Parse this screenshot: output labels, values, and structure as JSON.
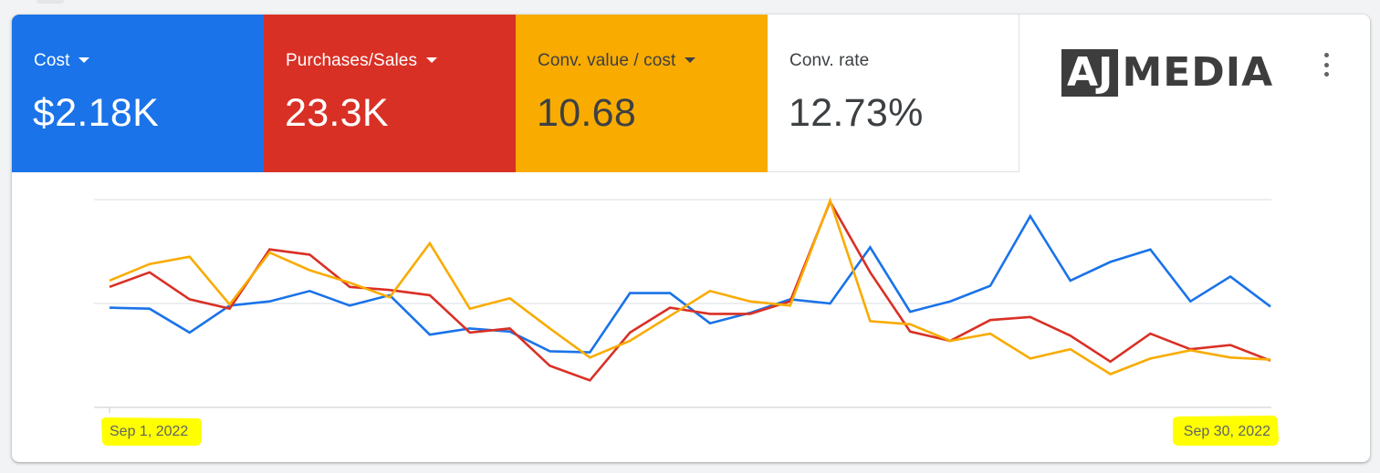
{
  "metrics": [
    {
      "label": "Cost",
      "value": "$2.18K",
      "color": "#1a73e8",
      "dropdown": true
    },
    {
      "label": "Purchases/Sales",
      "value": "23.3K",
      "color": "#d93025",
      "dropdown": true
    },
    {
      "label": "Conv. value / cost",
      "value": "10.68",
      "color": "#f9ab00",
      "dropdown": true
    },
    {
      "label": "Conv. rate",
      "value": "12.73%",
      "color": "#ffffff",
      "dropdown": false
    }
  ],
  "logo": {
    "box_text": "AJ",
    "text": "MEDIA"
  },
  "menu_icon": "more-vert-icon",
  "chart_data": {
    "type": "line",
    "x": [
      "Sep 1, 2022",
      "Sep 2, 2022",
      "Sep 3, 2022",
      "Sep 4, 2022",
      "Sep 5, 2022",
      "Sep 6, 2022",
      "Sep 7, 2022",
      "Sep 8, 2022",
      "Sep 9, 2022",
      "Sep 10, 2022",
      "Sep 11, 2022",
      "Sep 12, 2022",
      "Sep 13, 2022",
      "Sep 14, 2022",
      "Sep 15, 2022",
      "Sep 16, 2022",
      "Sep 17, 2022",
      "Sep 18, 2022",
      "Sep 19, 2022",
      "Sep 20, 2022",
      "Sep 21, 2022",
      "Sep 22, 2022",
      "Sep 23, 2022",
      "Sep 24, 2022",
      "Sep 25, 2022",
      "Sep 26, 2022",
      "Sep 27, 2022",
      "Sep 28, 2022",
      "Sep 29, 2022",
      "Sep 30, 2022"
    ],
    "x_tick_labels": [
      "Sep 1, 2022",
      "Sep 30, 2022"
    ],
    "ylim": [
      0,
      100
    ],
    "grid": true,
    "highlighted_labels": true,
    "series": [
      {
        "color": "#1a73e8",
        "values": [
          48,
          47.5,
          36,
          49,
          51,
          56,
          49,
          54,
          35,
          38,
          36.5,
          27,
          26.5,
          55,
          55,
          40.5,
          45.5,
          52,
          50,
          77,
          46,
          51,
          58.5,
          92,
          61,
          70,
          76,
          51,
          63,
          48.5
        ]
      },
      {
        "color": "#d93025",
        "values": [
          58,
          65,
          52,
          47.5,
          76,
          73.5,
          58,
          56.5,
          54,
          36,
          38,
          20,
          13,
          36,
          48,
          45,
          45,
          51,
          99,
          65,
          36.5,
          32,
          42,
          43.5,
          34.5,
          22,
          35.5,
          28,
          30,
          22.5
        ]
      },
      {
        "color": "#f9ab00",
        "values": [
          61,
          69,
          72.5,
          49.5,
          74.5,
          66,
          60,
          53,
          79,
          47.5,
          52.5,
          38,
          24,
          32,
          44,
          56,
          51,
          49,
          99.5,
          41.5,
          40,
          32,
          35.5,
          23.5,
          28,
          16,
          23.5,
          27.5,
          24,
          23
        ]
      }
    ]
  }
}
